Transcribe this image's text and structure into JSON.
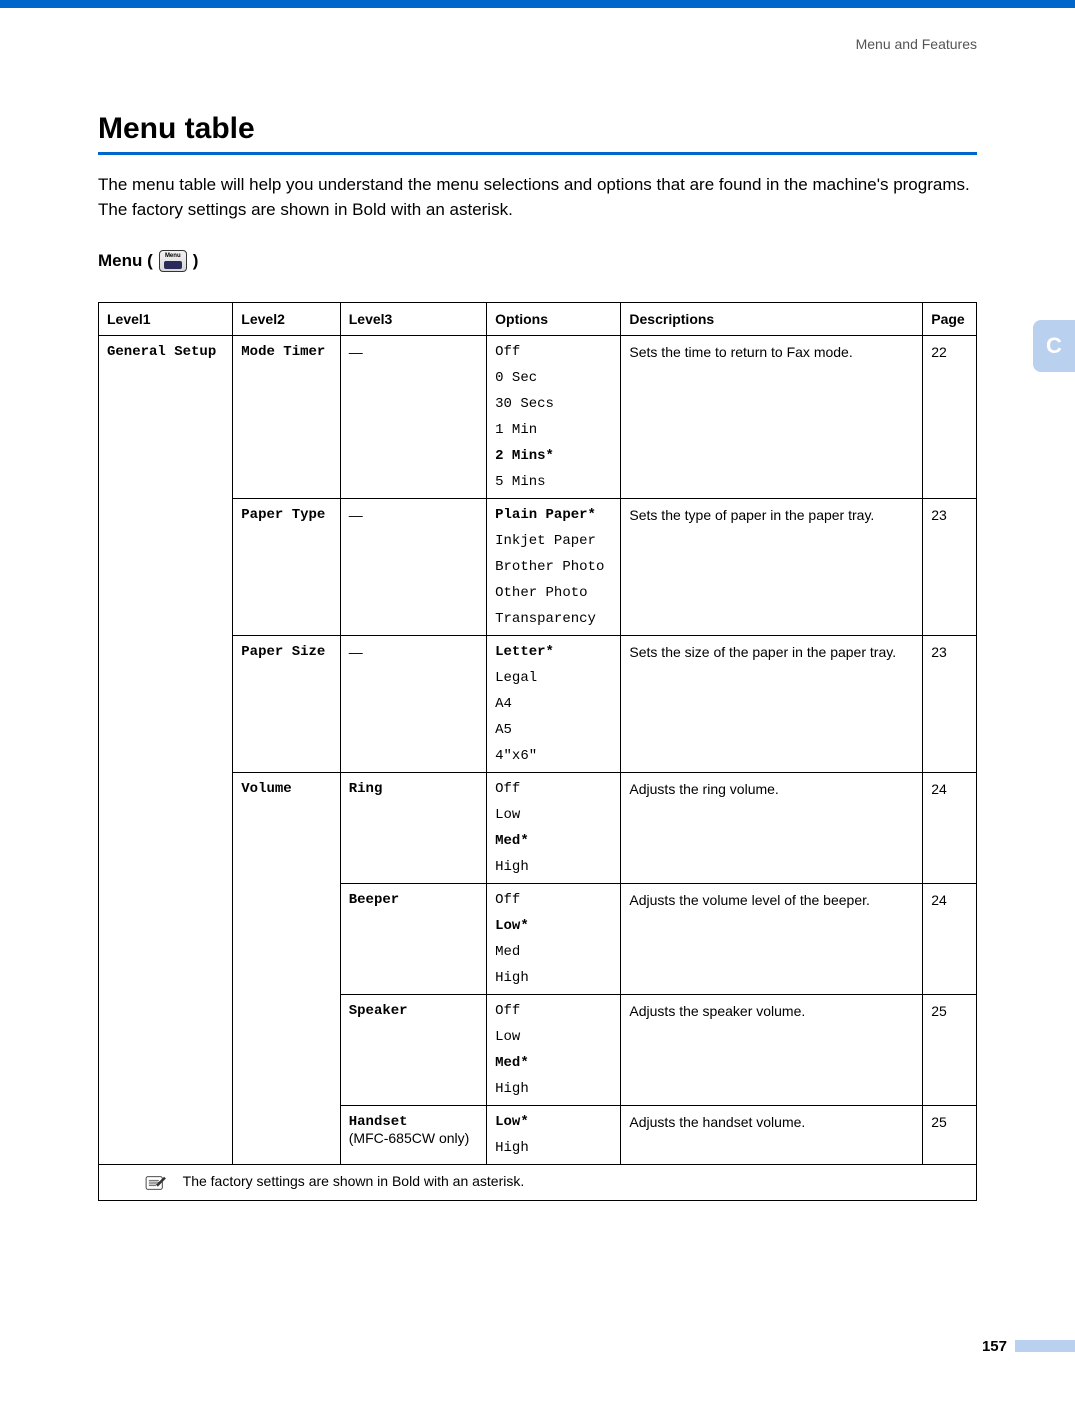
{
  "header": {
    "section": "Menu and Features"
  },
  "title": "Menu table",
  "intro": "The menu table will help you understand the menu selections and options that are found in the machine's programs. The factory settings are shown in Bold with an asterisk.",
  "menu_heading_prefix": "Menu (",
  "menu_heading_suffix": ")",
  "menu_btn_label": "Menu",
  "side_tab": "C",
  "table": {
    "headers": {
      "c1": "Level1",
      "c2": "Level2",
      "c3": "Level3",
      "c4": "Options",
      "c5": "Descriptions",
      "c6": "Page"
    },
    "level1": "General Setup",
    "rows": [
      {
        "level2": "Mode Timer",
        "level3": "—",
        "options": [
          "Off",
          "0 Sec",
          "30 Secs",
          "1 Min",
          "2 Mins*",
          "5 Mins"
        ],
        "default_index": 4,
        "description": "Sets the time to return to Fax mode.",
        "page": "22"
      },
      {
        "level2": "Paper Type",
        "level3": "—",
        "options": [
          "Plain Paper*",
          "Inkjet Paper",
          "Brother Photo",
          "Other Photo",
          "Transparency"
        ],
        "default_index": 0,
        "description": "Sets the type of paper in the paper tray.",
        "page": "23"
      },
      {
        "level2": "Paper Size",
        "level3": "—",
        "options": [
          "Letter*",
          "Legal",
          "A4",
          "A5",
          "4\"x6\""
        ],
        "default_index": 0,
        "description": "Sets the size of the paper in the paper tray.",
        "page": "23"
      },
      {
        "level2": "Volume",
        "level3": "Ring",
        "options": [
          "Off",
          "Low",
          "Med*",
          "High"
        ],
        "default_index": 2,
        "description": "Adjusts the ring volume.",
        "page": "24"
      },
      {
        "level3": "Beeper",
        "options": [
          "Off",
          "Low*",
          "Med",
          "High"
        ],
        "default_index": 1,
        "description": "Adjusts the volume level of the beeper.",
        "page": "24"
      },
      {
        "level3": "Speaker",
        "options": [
          "Off",
          "Low",
          "Med*",
          "High"
        ],
        "default_index": 2,
        "description": "Adjusts the speaker volume.",
        "page": "25"
      },
      {
        "level3": "Handset",
        "level3_note": "(MFC-685CW only)",
        "options": [
          "Low*",
          "High"
        ],
        "default_index": 0,
        "description": "Adjusts the handset volume.",
        "page": "25"
      }
    ],
    "footnote": "The factory settings are shown in Bold with an asterisk."
  },
  "page_number": "157"
}
